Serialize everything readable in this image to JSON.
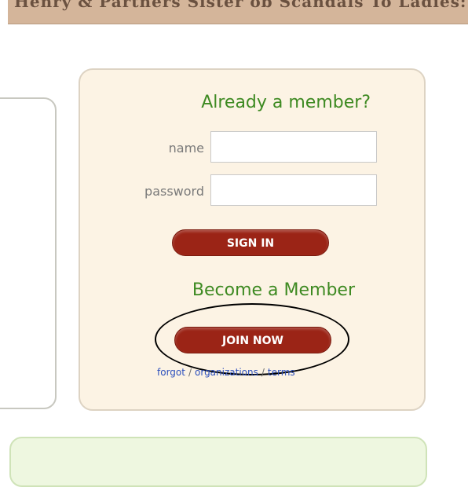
{
  "banner": {
    "text": "Henry & Partners Sister ob Scandals To Ladies: all"
  },
  "login": {
    "heading": "Already a member?",
    "name_label": "name",
    "password_label": "password",
    "name_value": "",
    "password_value": "",
    "signin_label": "SIGN IN"
  },
  "signup": {
    "heading": "Become a Member",
    "join_label": "JOIN NOW"
  },
  "links": {
    "forgot": "forgot",
    "separator": "/",
    "organizations": "organizations",
    "terms": "terms"
  },
  "colors": {
    "heading_green": "#3e8a22",
    "button_red": "#9b2416",
    "panel_bg": "#fcf3e4",
    "link_blue": "#2c4fbd"
  }
}
